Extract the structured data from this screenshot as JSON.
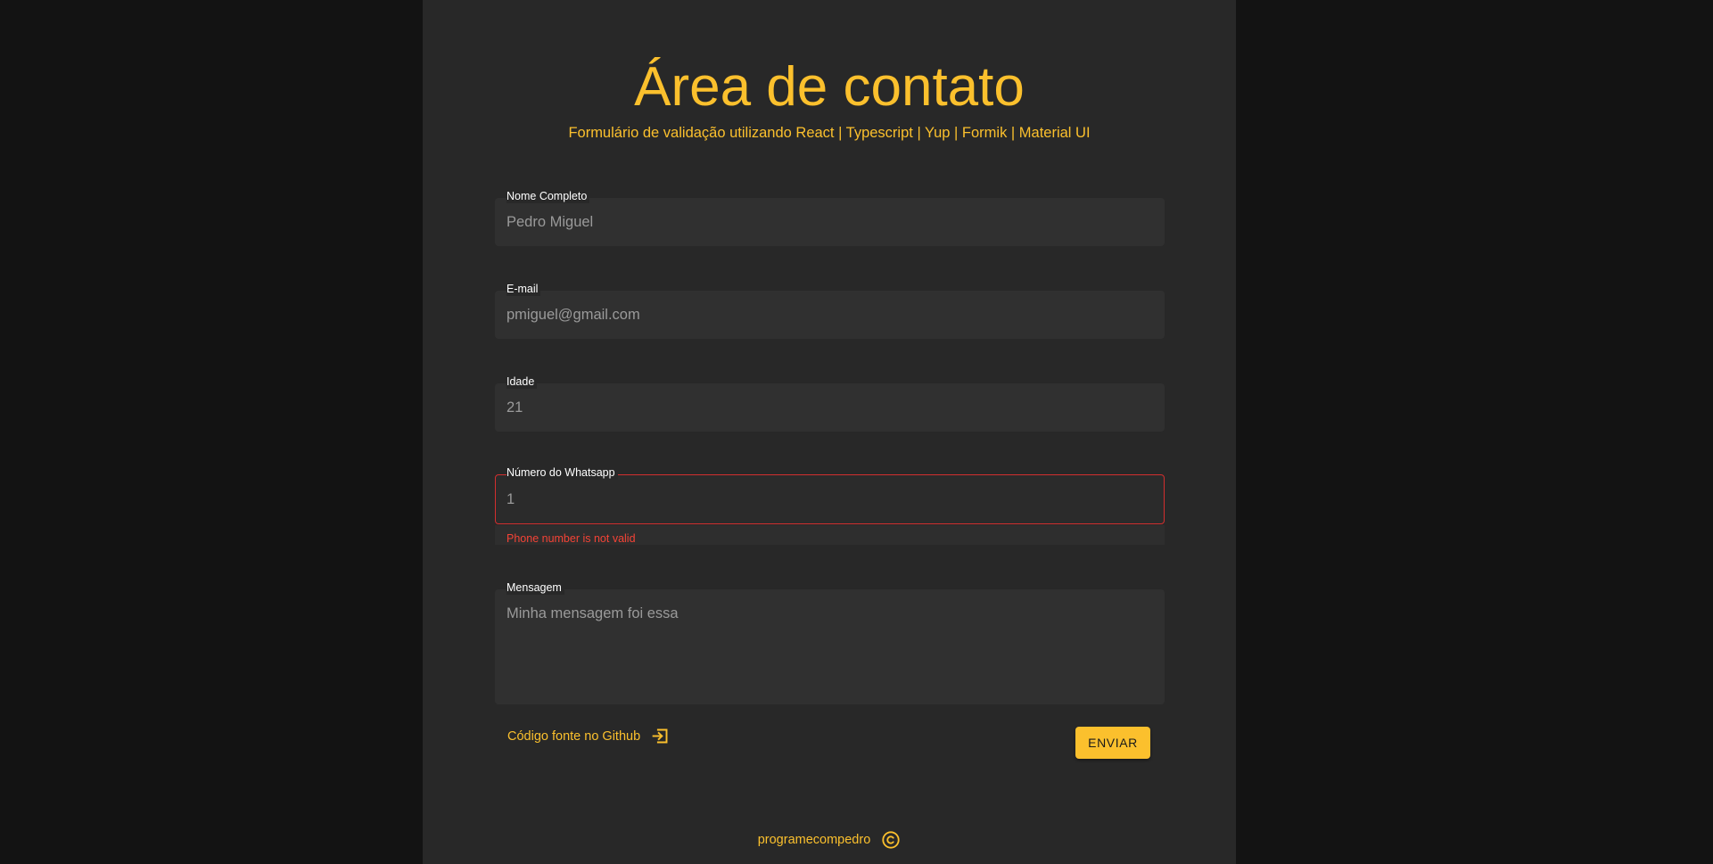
{
  "header": {
    "title": "Área de contato",
    "subtitle": "Formulário de validação utilizando React | Typescript | Yup | Formik | Material UI"
  },
  "form": {
    "fields": [
      {
        "label": "Nome Completo",
        "value": "Pedro Miguel"
      },
      {
        "label": "E-mail",
        "value": "pmiguel@gmail.com"
      },
      {
        "label": "Idade",
        "value": "21"
      },
      {
        "label": "Número do Whatsapp",
        "value": "1",
        "error": "Phone number is not valid"
      },
      {
        "label": "Mensagem",
        "value": "Minha mensagem foi essa"
      }
    ],
    "github_link": {
      "label": "Código fonte no Github",
      "icon": "login-icon"
    },
    "submit_label": "ENVIAR"
  },
  "footer": {
    "author": "programecompedro",
    "icon": "copyright-icon"
  },
  "colors": {
    "accent": "#fbc02d",
    "background": "#131313",
    "panel": "#282828",
    "error": "#d32f2f"
  }
}
